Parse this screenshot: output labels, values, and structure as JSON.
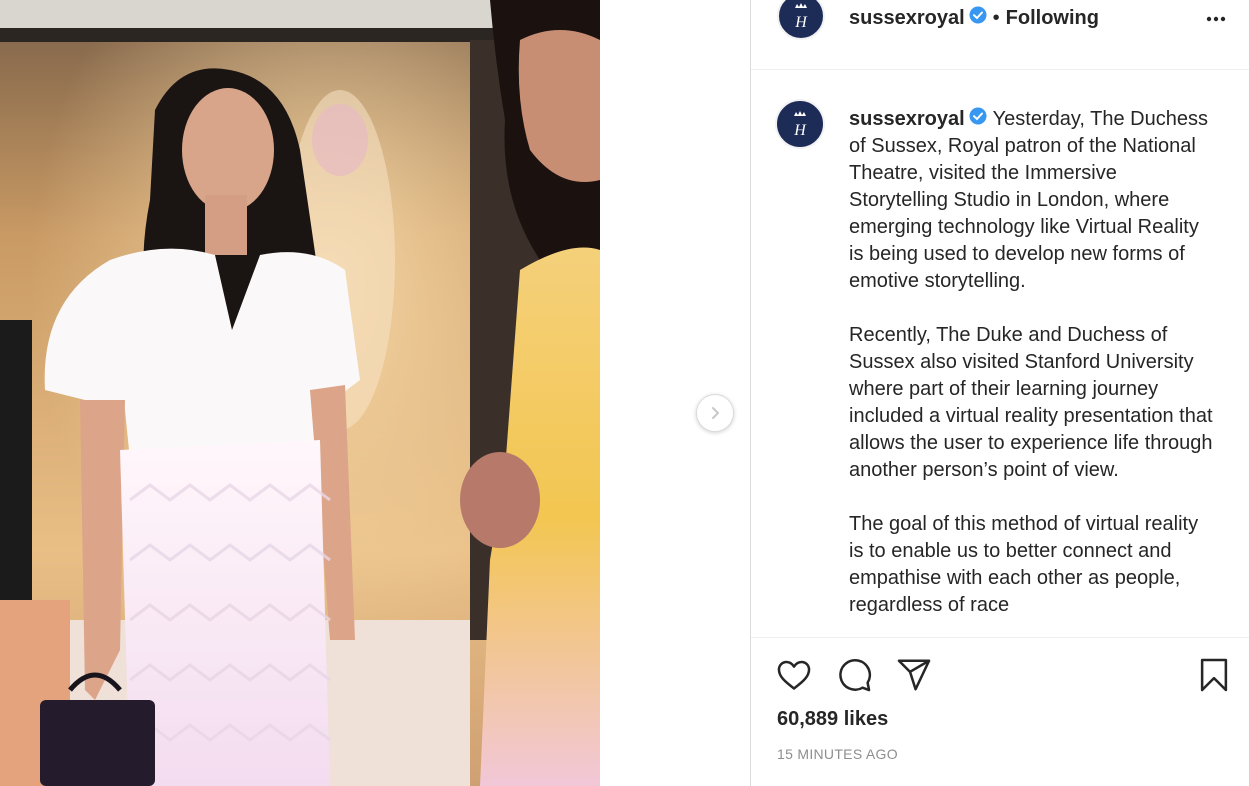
{
  "post": {
    "username": "sussexroyal",
    "follow_status": "Following",
    "separator": "•",
    "caption": [
      "Yesterday, The Duchess of Sussex, Royal patron of the National Theatre, visited the Immersive Storytelling Studio in London, where emerging technology like Virtual Reality is being used to develop new forms of emotive storytelling.",
      "Recently, The Duke and Duchess of Sussex also visited Stanford University where part of their learning journey included a virtual reality presentation that allows the user to experience life through another person’s point of view.",
      "The goal of this method of virtual reality is to enable us to better connect and empathise with each other as people, regardless of race"
    ],
    "likes": "60,889 likes",
    "timestamp": "15 MINUTES AGO"
  },
  "icons": {
    "verified": "verified-badge-icon",
    "more": "more-options-icon",
    "next": "chevron-right-icon",
    "like": "heart-icon",
    "comment": "comment-icon",
    "share": "paper-plane-icon",
    "save": "bookmark-icon"
  },
  "colors": {
    "verified_blue": "#3897f0",
    "avatar_navy": "#1d2b57",
    "text": "#262626",
    "muted": "#8e8e8e",
    "border": "#dbdbdb"
  }
}
